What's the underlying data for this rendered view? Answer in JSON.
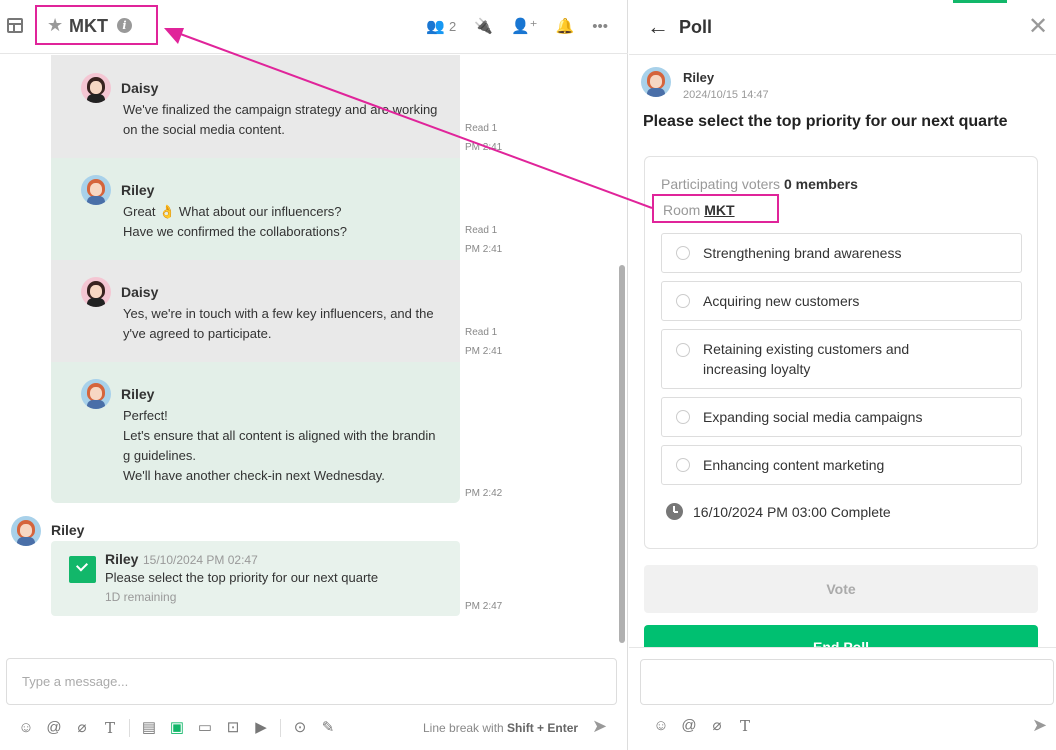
{
  "chat": {
    "room_title": "MKT",
    "member_count": "2",
    "messages": [
      {
        "sender": "Daisy",
        "text": "We've finalized the campaign strategy and are working\n on the social media content.",
        "read": "Read 1",
        "time": "PM 2:41"
      },
      {
        "sender": "Riley",
        "text": "Great 👌 What about our influencers?\nHave we confirmed the collaborations?",
        "read": "Read 1",
        "time": "PM 2:41"
      },
      {
        "sender": "Daisy",
        "text": "Yes, we're in touch with a few key influencers, and the\ny've agreed to participate.",
        "read": "Read 1",
        "time": "PM 2:41"
      },
      {
        "sender": "Riley",
        "text": "Perfect!\nLet's ensure that all content is aligned with the brandin\ng guidelines.\nWe'll have another check-in next Wednesday.",
        "time": "PM 2:42"
      }
    ],
    "poll_message": {
      "outer_sender": "Riley",
      "sender": "Riley",
      "timestamp": "15/10/2024 PM 02:47",
      "text": "Please select the top priority for our next quarte",
      "remaining": "1D remaining",
      "time": "PM 2:47"
    },
    "composer_placeholder": "Type a message...",
    "hint_prefix": "Line break with ",
    "hint_keys": "Shift + Enter"
  },
  "poll_panel": {
    "title": "Poll",
    "creator": "Riley",
    "created_at": "2024/10/15 14:47",
    "question": "Please select the top priority for our next quarte",
    "voters_label": "Participating voters",
    "voters_value": "0 members",
    "room_label": "Room",
    "room_name": "MKT",
    "options": [
      "Strengthening brand awareness",
      "Acquiring new customers",
      "Retaining existing customers and\nincreasing loyalty",
      "Expanding social media campaigns",
      "Enhancing content marketing"
    ],
    "deadline": "16/10/2024 PM 03:00 Complete",
    "vote_label": "Vote",
    "end_poll_label": "End Poll"
  },
  "colors": {
    "highlight": "#e0249a",
    "accent_green": "#00c071"
  }
}
